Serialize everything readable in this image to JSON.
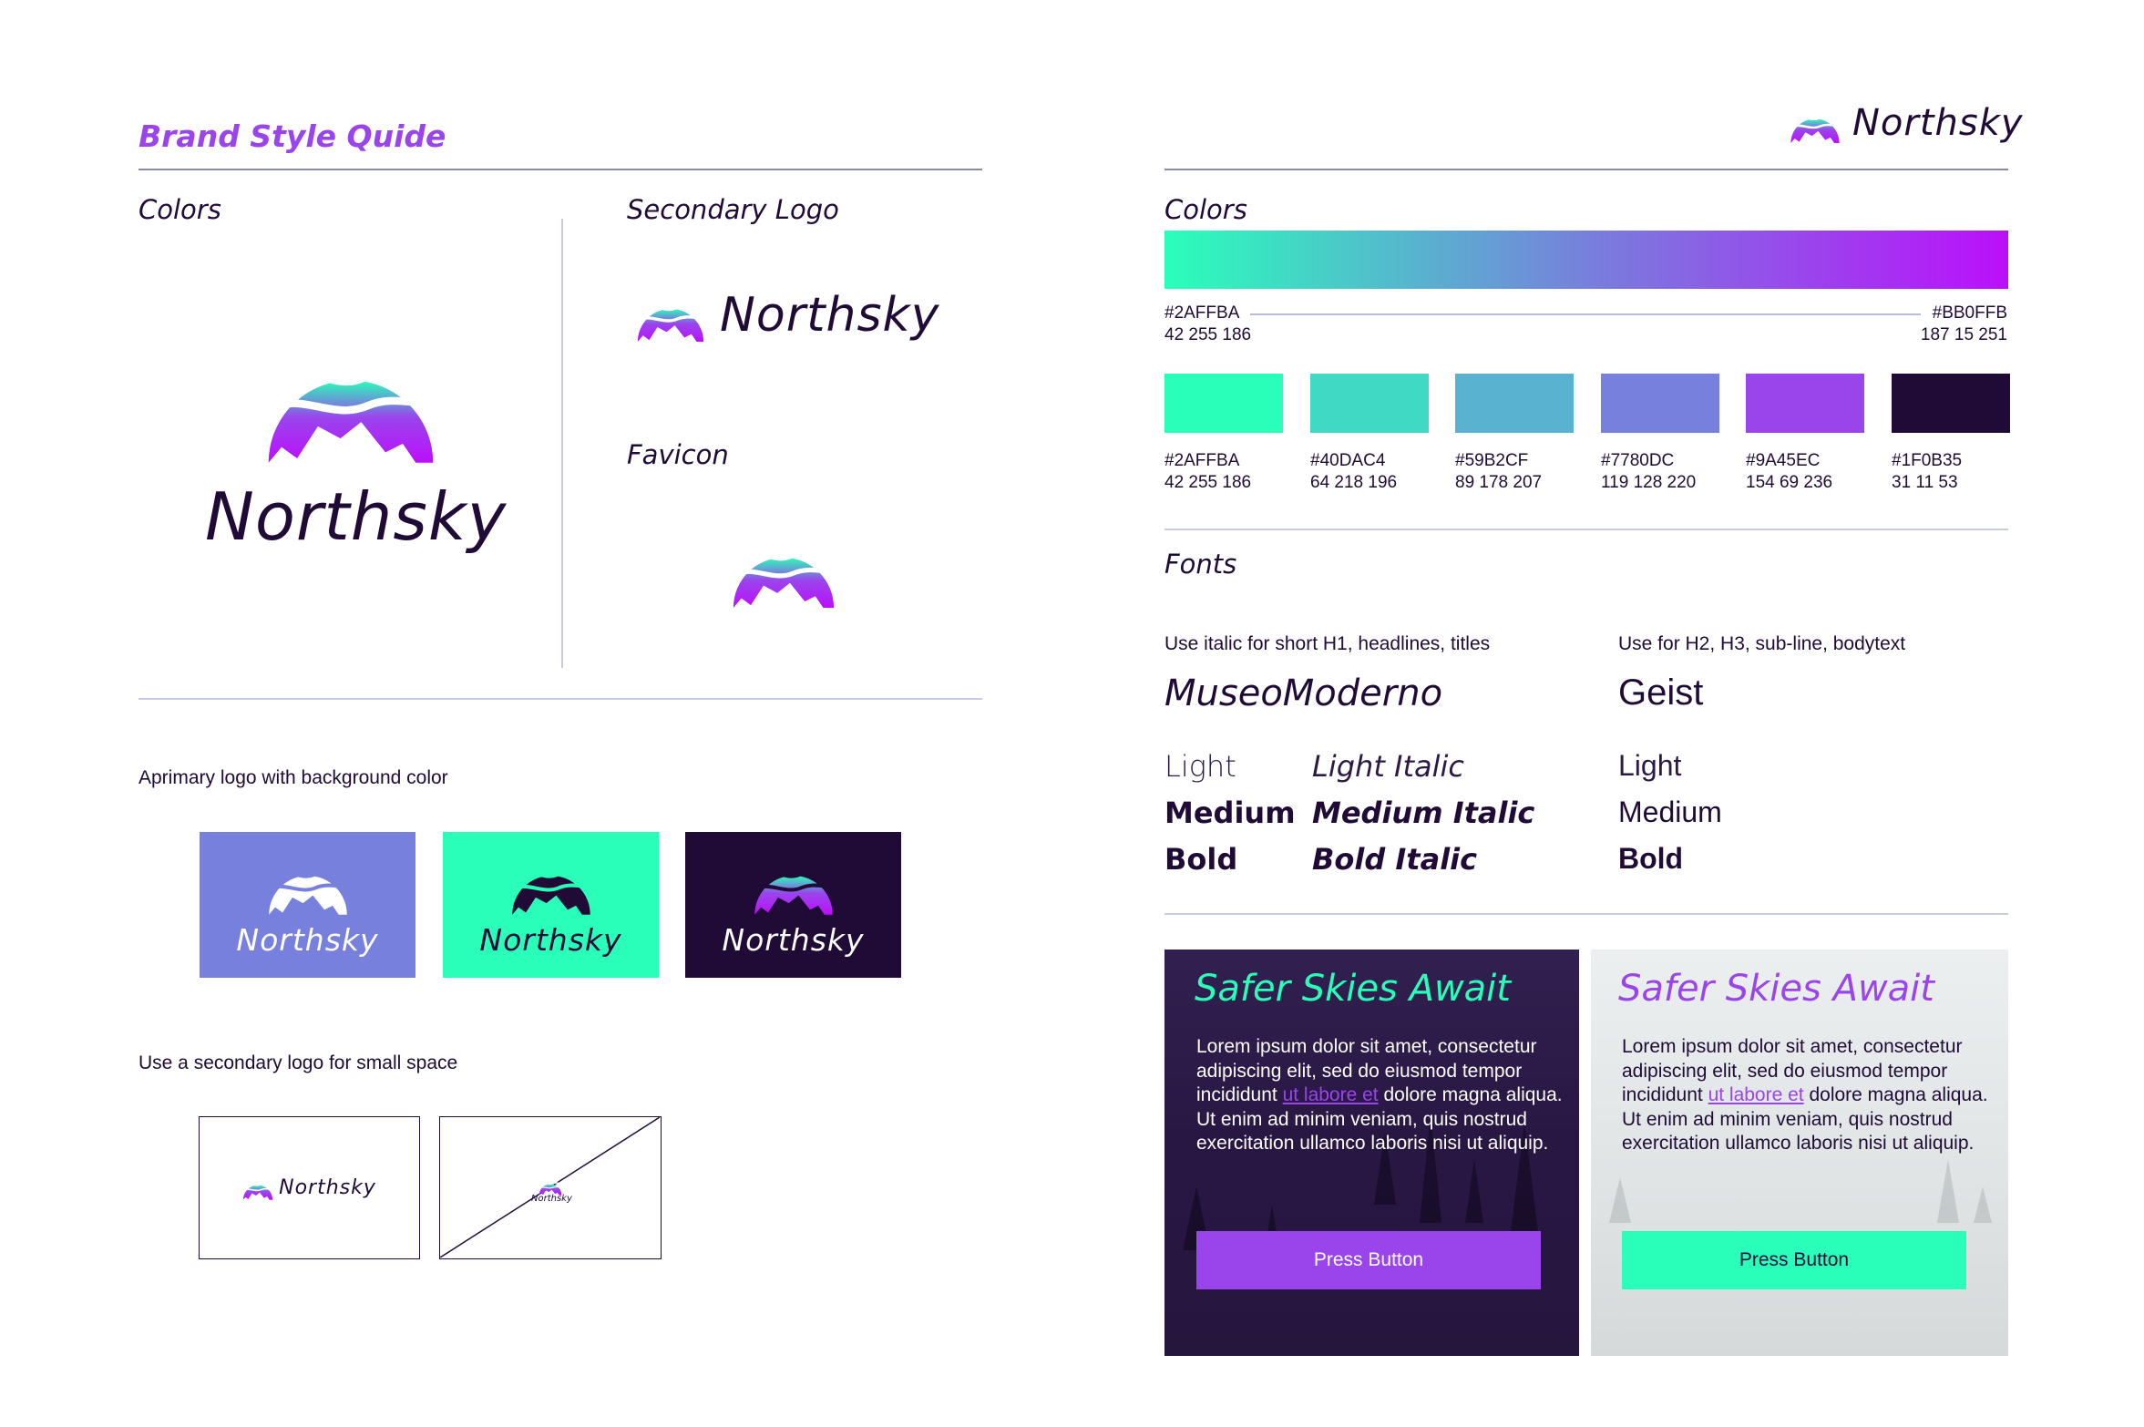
{
  "brand": {
    "title": "Brand Style Quide",
    "name": "Northsky"
  },
  "left": {
    "colors_heading": "Colors",
    "secondary_logo_heading": "Secondary Logo",
    "favicon_heading": "Favicon",
    "bg_logo_caption": "Aprimary logo with background color",
    "small_space_caption": "Use a secondary logo for small space"
  },
  "right": {
    "colors_heading": "Colors",
    "fonts_heading": "Fonts",
    "gradient": {
      "start_hex": "#2AFFBA",
      "start_rgb": "42 255 186",
      "end_hex": "#BB0FFB",
      "end_rgb": "187 15 251"
    },
    "swatches": [
      {
        "hex": "#2AFFBA",
        "rgb": "42 255 186",
        "color": "#2AFFBA"
      },
      {
        "hex": "#40DAC4",
        "rgb": "64 218 196",
        "color": "#40DAC4"
      },
      {
        "hex": "#59B2CF",
        "rgb": "89 178 207",
        "color": "#59B2CF"
      },
      {
        "hex": "#7780DC",
        "rgb": "119 128 220",
        "color": "#7780DC"
      },
      {
        "hex": "#9A45EC",
        "rgb": "154 69 236",
        "color": "#9A45EC"
      },
      {
        "hex": "#1F0B35",
        "rgb": "31 11 53",
        "color": "#1F0B35"
      }
    ],
    "fonts": {
      "primary_note": "Use italic for short H1, headlines, titles",
      "primary_name": "MuseoModerno",
      "secondary_note": "Use for H2, H3, sub-line, bodytext",
      "secondary_name": "Geist",
      "light": "Light",
      "medium": "Medium",
      "bold": "Bold",
      "light_italic": "Light Italic",
      "medium_italic": "Medium Italic",
      "bold_italic": "Bold Italic"
    },
    "cards": {
      "title": "Safer Skies Await",
      "body_before_link": "Lorem ipsum dolor sit amet, consectetur adipiscing elit, sed do eiusmod tempor incididunt ",
      "link": "ut labore et",
      "body_after_link": " dolore magna aliqua. Ut enim ad minim veniam, quis nostrud exercitation ullamco laboris nisi ut aliquip.",
      "button": "Press Button"
    }
  },
  "colors": {
    "primary_dark": "#1F0B35",
    "accent_purple": "#9A45EC",
    "mint": "#2AFFBA",
    "periwinkle": "#7780DC"
  }
}
